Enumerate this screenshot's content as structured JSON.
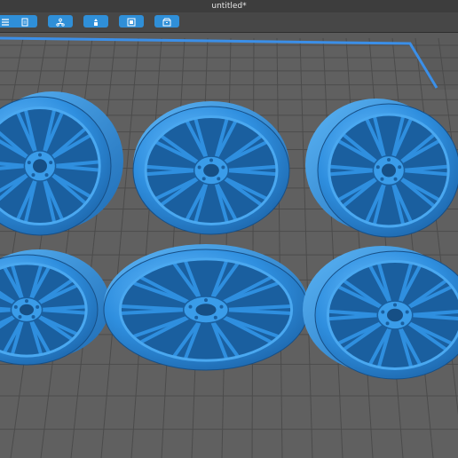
{
  "window": {
    "title": "untitled*"
  },
  "toolbar": {
    "buttons": [
      {
        "icon": "list-icon"
      },
      {
        "icon": "document-icon"
      },
      {
        "icon": "network-icon"
      },
      {
        "icon": "support-icon"
      },
      {
        "icon": "frame-icon"
      },
      {
        "icon": "archive-icon"
      }
    ]
  },
  "viewport": {
    "build_plate_color": "#5f5f5f",
    "grid_color": "#4b4b4b",
    "border_color": "#3c8ee6",
    "model_color": "#2f8fdf",
    "model_count": 6
  }
}
